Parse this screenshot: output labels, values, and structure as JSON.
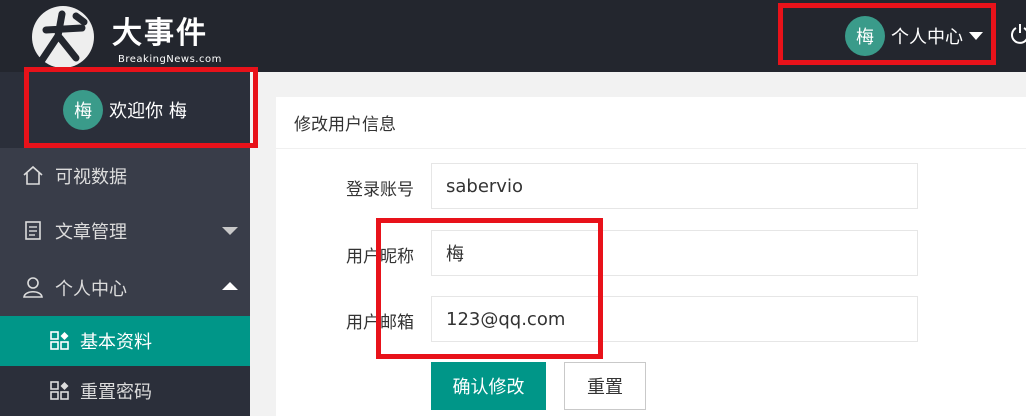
{
  "header": {
    "logo_title": "大事件",
    "logo_subtitle": "BreakingNews.com",
    "user_avatar": "梅",
    "user_menu_label": "个人中心",
    "highlight_color": "#e8121a"
  },
  "sidebar": {
    "welcome_avatar": "梅",
    "welcome_text": "欢迎你 梅",
    "items": [
      {
        "label": "可视数据",
        "icon": "home-icon"
      },
      {
        "label": "文章管理",
        "icon": "document-icon"
      },
      {
        "label": "个人中心",
        "icon": "user-icon"
      }
    ],
    "sub_items": [
      {
        "label": "基本资料",
        "icon": "grid-icon",
        "active": true
      },
      {
        "label": "重置密码",
        "icon": "grid-icon",
        "active": false
      }
    ]
  },
  "card": {
    "title": "修改用户信息",
    "fields": [
      {
        "label": "登录账号",
        "value": "sabervio"
      },
      {
        "label": "用户昵称",
        "value": "梅"
      },
      {
        "label": "用户邮箱",
        "value": "123@qq.com"
      }
    ],
    "submit_label": "确认修改",
    "reset_label": "重置"
  },
  "colors": {
    "header_bg": "#23262e",
    "sidebar_bg": "#393d49",
    "accent": "#009688",
    "avatar_bg": "#3a9b8a"
  }
}
